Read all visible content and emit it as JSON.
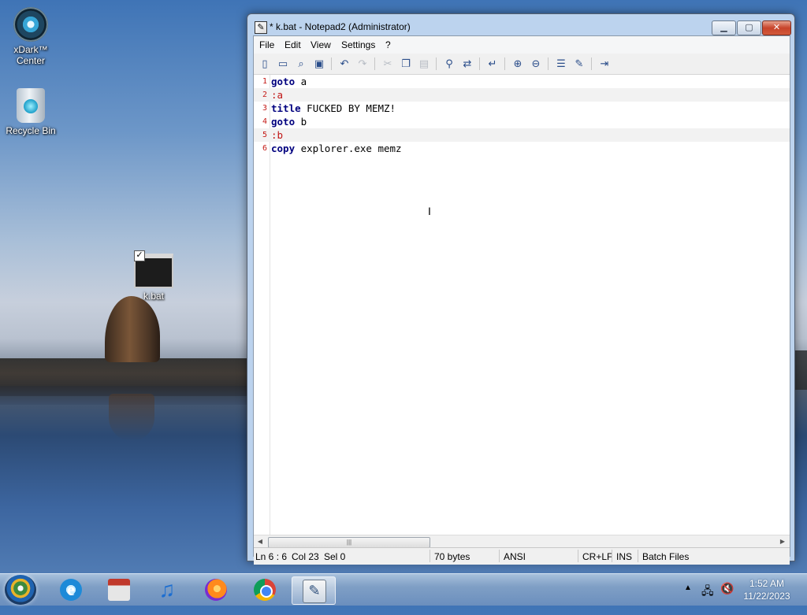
{
  "desktop": {
    "icons": [
      {
        "label": "xDark™ Center"
      },
      {
        "label": "Recycle Bin"
      },
      {
        "label": "k.bat"
      }
    ]
  },
  "window": {
    "title": "* k.bat - Notepad2 (Administrator)",
    "controls": {
      "minimize": "▁",
      "maximize": "▢",
      "close": "✕"
    },
    "menu": [
      "File",
      "Edit",
      "View",
      "Settings",
      "?"
    ],
    "toolbar_icons": [
      "new-icon",
      "open-icon",
      "browse-icon",
      "save-icon",
      "undo-icon",
      "redo-icon",
      "cut-icon",
      "copy-icon",
      "paste-icon",
      "find-icon",
      "replace-icon",
      "wordwrap-icon",
      "zoom-in-icon",
      "zoom-out-icon",
      "scheme-icon",
      "settings-icon",
      "exit-icon"
    ]
  },
  "editor": {
    "lines": [
      {
        "n": "1",
        "kw": "goto",
        "rest": " a"
      },
      {
        "n": "2",
        "label": ":a"
      },
      {
        "n": "3",
        "kw": "title",
        "rest": " FUCKED BY MEMZ!"
      },
      {
        "n": "4",
        "kw": "goto",
        "rest": " b"
      },
      {
        "n": "5",
        "label": ":b"
      },
      {
        "n": "6",
        "kw": "copy",
        "rest": " explorer.exe memz"
      }
    ]
  },
  "status": {
    "position": "Ln 6 : 6",
    "column": "Col 23",
    "selection": "Sel 0",
    "size": "70 bytes",
    "encoding": "ANSI",
    "eol": "CR+LF",
    "mode": "INS",
    "scheme": "Batch Files"
  },
  "taskbar": {
    "apps": [
      "internet-explorer-icon",
      "store-icon",
      "music-icon",
      "firefox-icon",
      "chrome-icon",
      "notepad2-icon"
    ],
    "clock": {
      "time": "1:52 AM",
      "date": "11/22/2023"
    }
  },
  "colors": {
    "keyword": "#00007f",
    "label": "#c01515",
    "line_number": "#c41a16"
  }
}
